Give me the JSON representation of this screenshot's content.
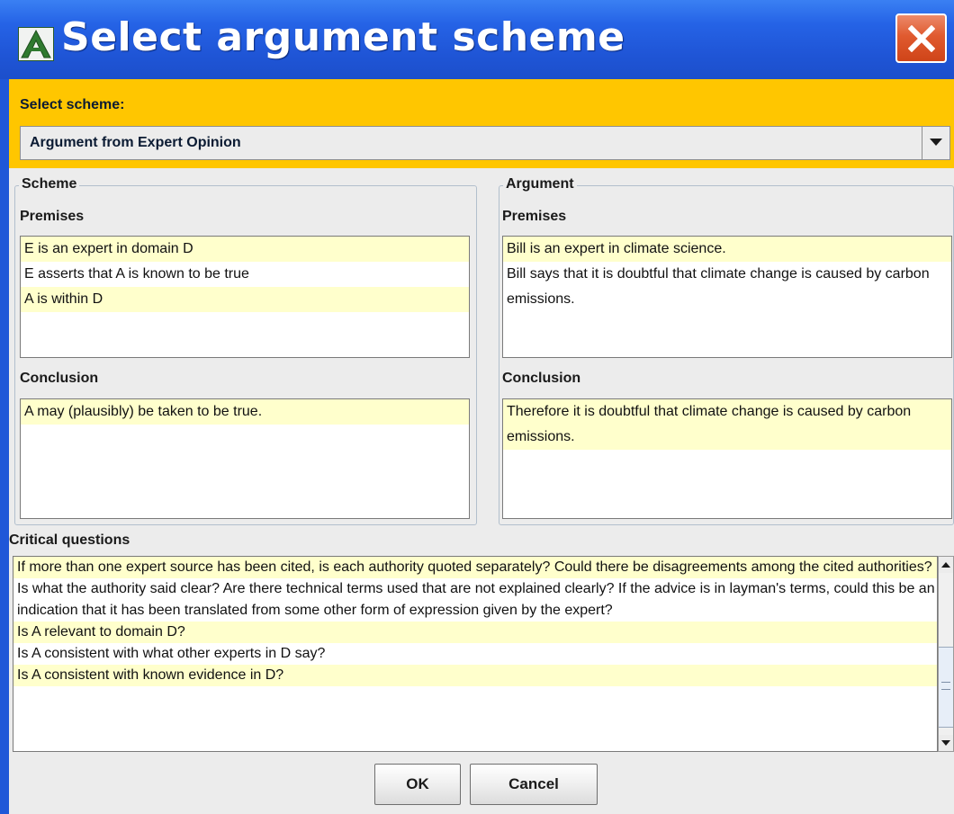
{
  "window": {
    "title": "Select argument scheme",
    "app_icon_letter": "A"
  },
  "selector": {
    "label": "Select scheme:",
    "selected_value": "Argument from Expert Opinion"
  },
  "scheme": {
    "group_title": "Scheme",
    "premises_label": "Premises",
    "premises": [
      "E is an expert in domain D",
      "E asserts that A is known to be true",
      "A is within D"
    ],
    "conclusion_label": "Conclusion",
    "conclusion": "A may (plausibly) be taken to be true."
  },
  "argument": {
    "group_title": "Argument",
    "premises_label": "Premises",
    "premises": [
      "Bill is an expert in climate science.",
      "Bill says that it is doubtful that climate change is caused by carbon emissions."
    ],
    "conclusion_label": "Conclusion",
    "conclusion": "Therefore it is doubtful that climate change is caused by carbon emissions."
  },
  "critical_questions": {
    "label": "Critical questions",
    "items": [
      "If more than one expert source has been cited, is each authority quoted separately? Could there be disagreements among the cited authorities?",
      "Is what the authority said clear? Are there technical terms used that are not explained clearly? If the advice is in layman's terms, could this be an indication that it has been translated from some other form of expression given by the expert?",
      "Is A relevant to domain D?",
      "Is A consistent with what other experts in D say?",
      "Is A consistent with known evidence in D?"
    ]
  },
  "buttons": {
    "ok": "OK",
    "cancel": "Cancel"
  },
  "colors": {
    "title_bar": "#2563e6",
    "select_bar": "#ffc600",
    "item_highlight": "#ffffcc",
    "close_button": "#e05a2f"
  },
  "icons": {
    "app": "app-logo-icon",
    "close": "close-icon",
    "dropdown": "chevron-down-icon",
    "scroll_up": "arrow-up-icon",
    "scroll_down": "arrow-down-icon"
  }
}
